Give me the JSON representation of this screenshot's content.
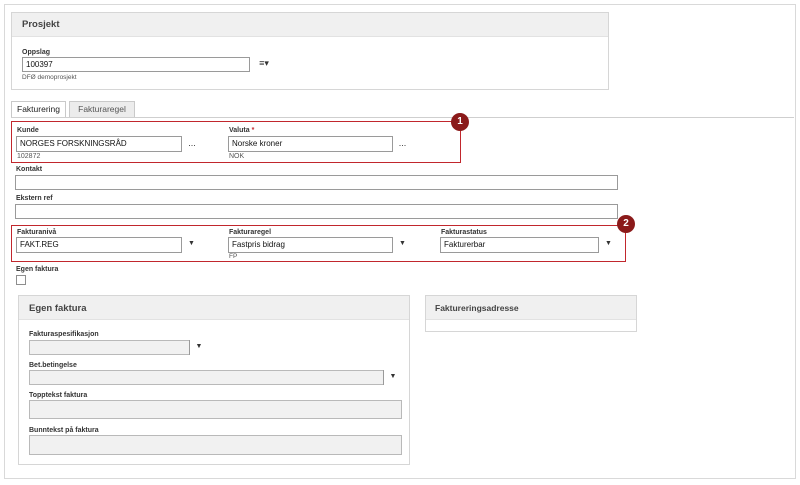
{
  "project_panel": {
    "title": "Prosjekt",
    "lookup_label": "Oppslag",
    "lookup_value": "100397",
    "lookup_button_icon": "list-filter-icon",
    "lookup_subtext": "DFØ demoprosjekt"
  },
  "tabs": [
    {
      "label": "Fakturering",
      "active": true
    },
    {
      "label": "Fakturaregel",
      "active": false
    }
  ],
  "customer": {
    "label": "Kunde",
    "value": "NORGES FORSKNINGSRÅD",
    "sub": "102872",
    "button": "..."
  },
  "currency": {
    "label": "Valuta",
    "required_mark": "*",
    "value": "Norske kroner",
    "sub": "NOK",
    "button": "..."
  },
  "contact": {
    "label": "Kontakt",
    "value": ""
  },
  "external_ref": {
    "label": "Ekstern ref",
    "value": ""
  },
  "invoice_level": {
    "label": "Fakturanivå",
    "value": "FAKT.REG"
  },
  "invoice_rule": {
    "label": "Fakturaregel",
    "value": "Fastpris bidrag",
    "sub": "FP"
  },
  "invoice_status": {
    "label": "Fakturastatus",
    "value": "Fakturerbar"
  },
  "own_invoice": {
    "label": "Egen faktura",
    "checked": false
  },
  "own_invoice_panel": {
    "title": "Egen faktura",
    "spec_label": "Fakturaspesifikasjon",
    "spec_value": "",
    "terms_label": "Bet.betingelse",
    "terms_value": "",
    "header_text_label": "Topptekst faktura",
    "header_text_value": "",
    "footer_text_label": "Bunntekst på faktura",
    "footer_text_value": ""
  },
  "address_panel": {
    "title": "Faktureringsadresse"
  },
  "callouts": [
    "1",
    "2"
  ],
  "colors": {
    "highlight": "#c1272d",
    "badge": "#8b1a1a"
  },
  "icons": {
    "dropdown": "▼",
    "lookup": "≡▾"
  }
}
